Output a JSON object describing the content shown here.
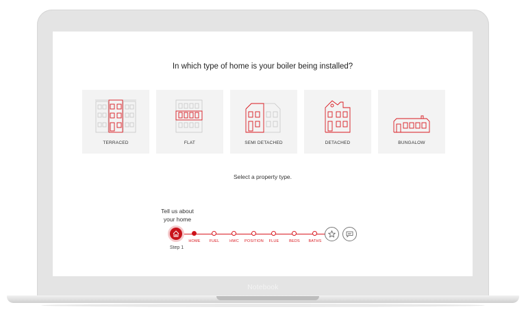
{
  "question": "In which type of home is your boiler being installed?",
  "property_types": [
    {
      "label": "TERRACED",
      "icon": "terraced-house-icon"
    },
    {
      "label": "FLAT",
      "icon": "flat-icon"
    },
    {
      "label": "SEMI DETACHED",
      "icon": "semi-detached-house-icon"
    },
    {
      "label": "DETACHED",
      "icon": "detached-house-icon"
    },
    {
      "label": "BUNGALOW",
      "icon": "bungalow-icon"
    }
  ],
  "hint": "Select a property type.",
  "progress": {
    "title_line1": "Tell us about",
    "title_line2": "your home",
    "step_label": "Step 1",
    "steps": [
      "HOME",
      "FUEL",
      "HWC",
      "POSITION",
      "FLUE",
      "BEDS",
      "BATHS"
    ],
    "current_step": 0
  },
  "device_label": "Notebook",
  "colors": {
    "accent": "#d9171e",
    "card_bg": "#f3f3f3"
  }
}
